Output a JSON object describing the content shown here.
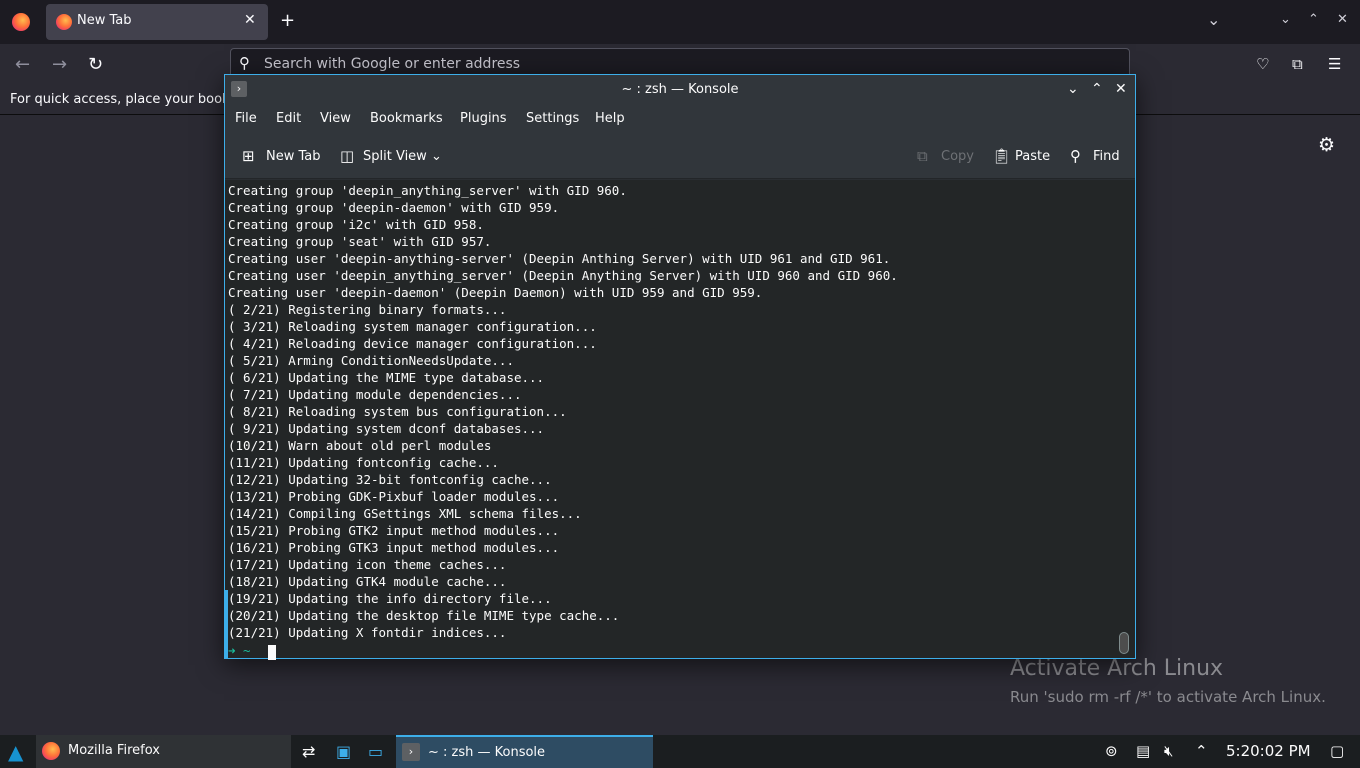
{
  "firefox": {
    "tab_title": "New Tab",
    "url_placeholder": "Search with Google or enter address",
    "bookmarks_hint": "For quick access, place your bookmarks here",
    "icons": {
      "back": "arrow-left-icon",
      "forward": "arrow-right-icon",
      "reload": "reload-icon",
      "pocket": "pocket-icon",
      "extensions": "extensions-icon",
      "menu": "hamburger-menu-icon",
      "settings": "gear-icon"
    }
  },
  "konsole": {
    "title": "~ : zsh — Konsole",
    "menu": [
      "File",
      "Edit",
      "View",
      "Bookmarks",
      "Plugins",
      "Settings",
      "Help"
    ],
    "toolbar": {
      "new_tab": "New Tab",
      "split_view": "Split View",
      "copy": "Copy",
      "paste": "Paste",
      "find": "Find"
    },
    "lines": [
      "Creating group 'deepin_anything_server' with GID 960.",
      "Creating group 'deepin-daemon' with GID 959.",
      "Creating group 'i2c' with GID 958.",
      "Creating group 'seat' with GID 957.",
      "Creating user 'deepin-anything-server' (Deepin Anthing Server) with UID 961 and GID 961.",
      "Creating user 'deepin_anything_server' (Deepin Anything Server) with UID 960 and GID 960.",
      "Creating user 'deepin-daemon' (Deepin Daemon) with UID 959 and GID 959.",
      "( 2/21) Registering binary formats...",
      "( 3/21) Reloading system manager configuration...",
      "( 4/21) Reloading device manager configuration...",
      "( 5/21) Arming ConditionNeedsUpdate...",
      "( 6/21) Updating the MIME type database...",
      "( 7/21) Updating module dependencies...",
      "( 8/21) Reloading system bus configuration...",
      "( 9/21) Updating system dconf databases...",
      "(10/21) Warn about old perl modules",
      "(11/21) Updating fontconfig cache...",
      "(12/21) Updating 32-bit fontconfig cache...",
      "(13/21) Probing GDK-Pixbuf loader modules...",
      "(14/21) Compiling GSettings XML schema files...",
      "(15/21) Probing GTK2 input method modules...",
      "(16/21) Probing GTK3 input method modules...",
      "(17/21) Updating icon theme caches...",
      "(18/21) Updating GTK4 module cache...",
      "(19/21) Updating the info directory file...",
      "(20/21) Updating the desktop file MIME type cache...",
      "(21/21) Updating X fontdir indices..."
    ],
    "prompt": "➜  ~"
  },
  "watermark": {
    "title": "Activate Arch Linux",
    "subtitle": "Run 'sudo rm -rf /*' to activate Arch Linux."
  },
  "taskbar": {
    "firefox_label": "Mozilla Firefox",
    "konsole_label": "~ : zsh — Konsole",
    "clock": "5:20:02 PM"
  }
}
